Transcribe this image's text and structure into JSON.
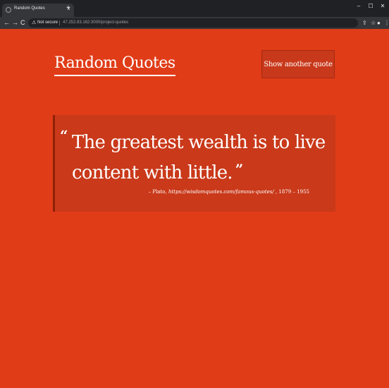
{
  "browser": {
    "tab_title": "Random Quotes",
    "tab_close": "×",
    "new_tab": "+",
    "window_controls": {
      "minimize": "–",
      "maximize": "☐",
      "close": "✕"
    },
    "nav": {
      "back": "←",
      "forward": "→",
      "reload": "C"
    },
    "security_label": "Not secure",
    "url": "47.252.83.162:3000/project-quotes",
    "toolbar_icons": [
      "share-icon",
      "star-icon",
      "profile-icon",
      "menu-icon"
    ]
  },
  "header": {
    "logo": "Random Quotes",
    "button_label": "Show another quote"
  },
  "quote": {
    "open_mark": "“",
    "text": "The greatest wealth is to live content with little.",
    "close_mark": "”",
    "author": "Plato",
    "source": "https://wisdomquotes.com/famous-quotes/",
    "years": "1879 – 1955"
  },
  "colors": {
    "page_bg": "#e03c17",
    "card_bg": "#c9391a",
    "card_border": "#8e2208",
    "text": "#ffffff"
  }
}
